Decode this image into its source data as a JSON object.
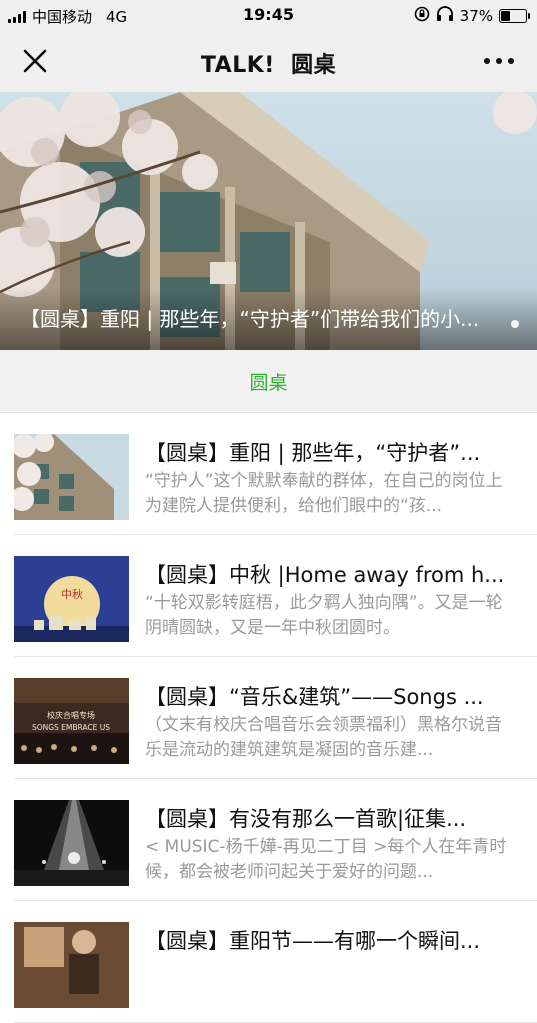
{
  "status_bar": {
    "carrier": "中国移动",
    "network": "4G",
    "time": "19:45",
    "battery": "37%"
  },
  "nav": {
    "title": "TALK!  圆桌",
    "close_icon": "close-icon",
    "more_icon": "more-icon"
  },
  "banner": {
    "caption": "【圆桌】重阳 | 那些年，“守护者”们带给我们的小..."
  },
  "section": {
    "label": "圆桌",
    "accent_color": "#2fb12f"
  },
  "articles": [
    {
      "title": "【圆桌】重阳 | 那些年，“守护者”...",
      "desc": "“守护人”这个默默奉献的群体，在自己的岗位上为建院人提供便利，给他们眼中的“孩..."
    },
    {
      "title": "【圆桌】中秋 |Home away from h...",
      "desc": "“十轮双影转庭梧，此夕羁人独向隅”。又是一轮阴晴圆缺，又是一年中秋团圆时。",
      "thumb_text": "中秋"
    },
    {
      "title": "【圆桌】“音乐&建筑”——Songs ...",
      "desc": "（文末有校庆合唱音乐会领票福利）黑格尔说音乐是流动的建筑建筑是凝固的音乐建...",
      "thumb_text_top": "校庆合唱专场",
      "thumb_text_bottom": "SONGS EMBRACE US"
    },
    {
      "title": "【圆桌】有没有那么一首歌|征集...",
      "desc": "< MUSIC-杨千嬅-再见二丁目 >每个人在年青时候，都会被老师问起关于爱好的问题..."
    },
    {
      "title": "【圆桌】重阳节——有哪一个瞬间...",
      "desc": ""
    }
  ]
}
